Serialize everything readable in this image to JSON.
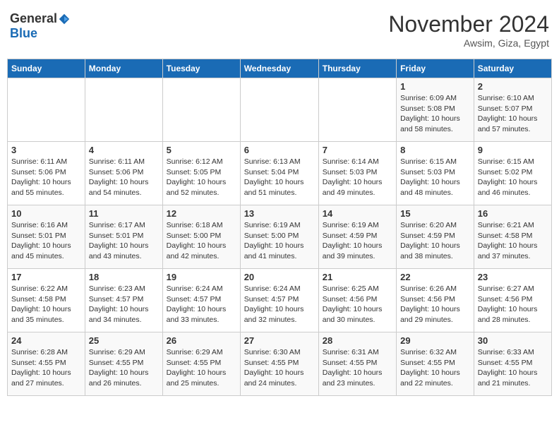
{
  "header": {
    "logo_general": "General",
    "logo_blue": "Blue",
    "month": "November 2024",
    "location": "Awsim, Giza, Egypt"
  },
  "weekdays": [
    "Sunday",
    "Monday",
    "Tuesday",
    "Wednesday",
    "Thursday",
    "Friday",
    "Saturday"
  ],
  "weeks": [
    [
      {
        "day": "",
        "info": ""
      },
      {
        "day": "",
        "info": ""
      },
      {
        "day": "",
        "info": ""
      },
      {
        "day": "",
        "info": ""
      },
      {
        "day": "",
        "info": ""
      },
      {
        "day": "1",
        "info": "Sunrise: 6:09 AM\nSunset: 5:08 PM\nDaylight: 10 hours and 58 minutes."
      },
      {
        "day": "2",
        "info": "Sunrise: 6:10 AM\nSunset: 5:07 PM\nDaylight: 10 hours and 57 minutes."
      }
    ],
    [
      {
        "day": "3",
        "info": "Sunrise: 6:11 AM\nSunset: 5:06 PM\nDaylight: 10 hours and 55 minutes."
      },
      {
        "day": "4",
        "info": "Sunrise: 6:11 AM\nSunset: 5:06 PM\nDaylight: 10 hours and 54 minutes."
      },
      {
        "day": "5",
        "info": "Sunrise: 6:12 AM\nSunset: 5:05 PM\nDaylight: 10 hours and 52 minutes."
      },
      {
        "day": "6",
        "info": "Sunrise: 6:13 AM\nSunset: 5:04 PM\nDaylight: 10 hours and 51 minutes."
      },
      {
        "day": "7",
        "info": "Sunrise: 6:14 AM\nSunset: 5:03 PM\nDaylight: 10 hours and 49 minutes."
      },
      {
        "day": "8",
        "info": "Sunrise: 6:15 AM\nSunset: 5:03 PM\nDaylight: 10 hours and 48 minutes."
      },
      {
        "day": "9",
        "info": "Sunrise: 6:15 AM\nSunset: 5:02 PM\nDaylight: 10 hours and 46 minutes."
      }
    ],
    [
      {
        "day": "10",
        "info": "Sunrise: 6:16 AM\nSunset: 5:01 PM\nDaylight: 10 hours and 45 minutes."
      },
      {
        "day": "11",
        "info": "Sunrise: 6:17 AM\nSunset: 5:01 PM\nDaylight: 10 hours and 43 minutes."
      },
      {
        "day": "12",
        "info": "Sunrise: 6:18 AM\nSunset: 5:00 PM\nDaylight: 10 hours and 42 minutes."
      },
      {
        "day": "13",
        "info": "Sunrise: 6:19 AM\nSunset: 5:00 PM\nDaylight: 10 hours and 41 minutes."
      },
      {
        "day": "14",
        "info": "Sunrise: 6:19 AM\nSunset: 4:59 PM\nDaylight: 10 hours and 39 minutes."
      },
      {
        "day": "15",
        "info": "Sunrise: 6:20 AM\nSunset: 4:59 PM\nDaylight: 10 hours and 38 minutes."
      },
      {
        "day": "16",
        "info": "Sunrise: 6:21 AM\nSunset: 4:58 PM\nDaylight: 10 hours and 37 minutes."
      }
    ],
    [
      {
        "day": "17",
        "info": "Sunrise: 6:22 AM\nSunset: 4:58 PM\nDaylight: 10 hours and 35 minutes."
      },
      {
        "day": "18",
        "info": "Sunrise: 6:23 AM\nSunset: 4:57 PM\nDaylight: 10 hours and 34 minutes."
      },
      {
        "day": "19",
        "info": "Sunrise: 6:24 AM\nSunset: 4:57 PM\nDaylight: 10 hours and 33 minutes."
      },
      {
        "day": "20",
        "info": "Sunrise: 6:24 AM\nSunset: 4:57 PM\nDaylight: 10 hours and 32 minutes."
      },
      {
        "day": "21",
        "info": "Sunrise: 6:25 AM\nSunset: 4:56 PM\nDaylight: 10 hours and 30 minutes."
      },
      {
        "day": "22",
        "info": "Sunrise: 6:26 AM\nSunset: 4:56 PM\nDaylight: 10 hours and 29 minutes."
      },
      {
        "day": "23",
        "info": "Sunrise: 6:27 AM\nSunset: 4:56 PM\nDaylight: 10 hours and 28 minutes."
      }
    ],
    [
      {
        "day": "24",
        "info": "Sunrise: 6:28 AM\nSunset: 4:55 PM\nDaylight: 10 hours and 27 minutes."
      },
      {
        "day": "25",
        "info": "Sunrise: 6:29 AM\nSunset: 4:55 PM\nDaylight: 10 hours and 26 minutes."
      },
      {
        "day": "26",
        "info": "Sunrise: 6:29 AM\nSunset: 4:55 PM\nDaylight: 10 hours and 25 minutes."
      },
      {
        "day": "27",
        "info": "Sunrise: 6:30 AM\nSunset: 4:55 PM\nDaylight: 10 hours and 24 minutes."
      },
      {
        "day": "28",
        "info": "Sunrise: 6:31 AM\nSunset: 4:55 PM\nDaylight: 10 hours and 23 minutes."
      },
      {
        "day": "29",
        "info": "Sunrise: 6:32 AM\nSunset: 4:55 PM\nDaylight: 10 hours and 22 minutes."
      },
      {
        "day": "30",
        "info": "Sunrise: 6:33 AM\nSunset: 4:55 PM\nDaylight: 10 hours and 21 minutes."
      }
    ]
  ]
}
